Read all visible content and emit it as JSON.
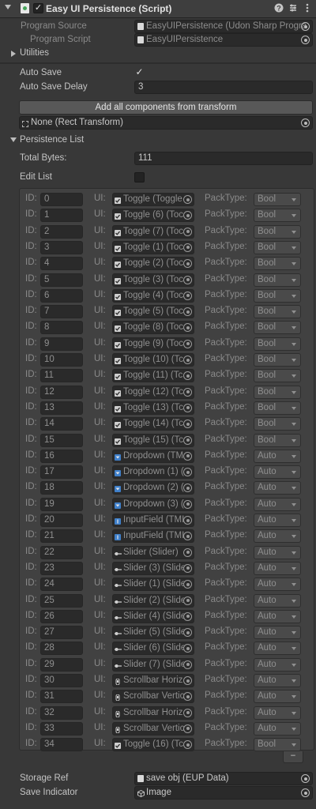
{
  "header": {
    "title": "Easy UI Persistence (Script)",
    "enabled": "✓",
    "help_icon": "help-icon",
    "preset_icon": "preset-icon",
    "menu_icon": "kebab-menu-icon"
  },
  "program_source": {
    "label": "Program Source",
    "value": "EasyUIPersistence (Udon Sharp Progra"
  },
  "program_script": {
    "label": "Program Script",
    "value": "EasyUIPersistence"
  },
  "utilities_label": "Utilities",
  "auto_save": {
    "label": "Auto Save",
    "value": "✓"
  },
  "auto_save_delay": {
    "label": "Auto Save Delay",
    "value": "3"
  },
  "add_all_button": "Add all components from transform",
  "rect_transform_field": "None (Rect Transform)",
  "persistence_list": {
    "label": "Persistence List",
    "total_bytes_label": "Total Bytes:",
    "total_bytes_value": "111",
    "edit_list_label": "Edit List",
    "id_label": "ID:",
    "ui_label": "UI:",
    "packtype_label": "PackType:",
    "items": [
      {
        "id": "0",
        "ui": "Toggle (Toggle",
        "kind": "toggle",
        "pack": "Bool"
      },
      {
        "id": "1",
        "ui": "Toggle (6) (Toc",
        "kind": "toggle",
        "pack": "Bool"
      },
      {
        "id": "2",
        "ui": "Toggle (7) (Toc",
        "kind": "toggle",
        "pack": "Bool"
      },
      {
        "id": "3",
        "ui": "Toggle (1) (Toc",
        "kind": "toggle",
        "pack": "Bool"
      },
      {
        "id": "4",
        "ui": "Toggle (2) (Toc",
        "kind": "toggle",
        "pack": "Bool"
      },
      {
        "id": "5",
        "ui": "Toggle (3) (Toc",
        "kind": "toggle",
        "pack": "Bool"
      },
      {
        "id": "6",
        "ui": "Toggle (4) (Toc",
        "kind": "toggle",
        "pack": "Bool"
      },
      {
        "id": "7",
        "ui": "Toggle (5) (Toc",
        "kind": "toggle",
        "pack": "Bool"
      },
      {
        "id": "8",
        "ui": "Toggle (8) (Toc",
        "kind": "toggle",
        "pack": "Bool"
      },
      {
        "id": "9",
        "ui": "Toggle (9) (Toc",
        "kind": "toggle",
        "pack": "Bool"
      },
      {
        "id": "10",
        "ui": "Toggle (10) (Tc",
        "kind": "toggle",
        "pack": "Bool"
      },
      {
        "id": "11",
        "ui": "Toggle (11) (Tc",
        "kind": "toggle",
        "pack": "Bool"
      },
      {
        "id": "12",
        "ui": "Toggle (12) (Tc",
        "kind": "toggle",
        "pack": "Bool"
      },
      {
        "id": "13",
        "ui": "Toggle (13) (Tc",
        "kind": "toggle",
        "pack": "Bool"
      },
      {
        "id": "14",
        "ui": "Toggle (14) (Tc",
        "kind": "toggle",
        "pack": "Bool"
      },
      {
        "id": "15",
        "ui": "Toggle (15) (Tc",
        "kind": "toggle",
        "pack": "Bool"
      },
      {
        "id": "16",
        "ui": "Dropdown (TM",
        "kind": "dropdown",
        "pack": "Auto"
      },
      {
        "id": "17",
        "ui": "Dropdown (1) (",
        "kind": "dropdown",
        "pack": "Auto"
      },
      {
        "id": "18",
        "ui": "Dropdown (2) (",
        "kind": "dropdown",
        "pack": "Auto"
      },
      {
        "id": "19",
        "ui": "Dropdown (3) (",
        "kind": "dropdown",
        "pack": "Auto"
      },
      {
        "id": "20",
        "ui": "InputField (TMI",
        "kind": "input",
        "pack": "Auto"
      },
      {
        "id": "21",
        "ui": "InputField (TMI",
        "kind": "input",
        "pack": "Auto"
      },
      {
        "id": "22",
        "ui": "Slider (Slider)",
        "kind": "slider",
        "pack": "Auto"
      },
      {
        "id": "23",
        "ui": "Slider (3) (Slide",
        "kind": "slider",
        "pack": "Auto"
      },
      {
        "id": "24",
        "ui": "Slider (1) (Slide",
        "kind": "slider",
        "pack": "Auto"
      },
      {
        "id": "25",
        "ui": "Slider (2) (Slide",
        "kind": "slider",
        "pack": "Auto"
      },
      {
        "id": "26",
        "ui": "Slider (4) (Slide",
        "kind": "slider",
        "pack": "Auto"
      },
      {
        "id": "27",
        "ui": "Slider (5) (Slide",
        "kind": "slider",
        "pack": "Auto"
      },
      {
        "id": "28",
        "ui": "Slider (6) (Slide",
        "kind": "slider",
        "pack": "Auto"
      },
      {
        "id": "29",
        "ui": "Slider (7) (Slide",
        "kind": "slider",
        "pack": "Auto"
      },
      {
        "id": "30",
        "ui": "Scrollbar Horiz",
        "kind": "scrollbar",
        "pack": "Auto"
      },
      {
        "id": "31",
        "ui": "Scrollbar Vertic",
        "kind": "scrollbar",
        "pack": "Auto"
      },
      {
        "id": "32",
        "ui": "Scrollbar Horiz",
        "kind": "scrollbar",
        "pack": "Auto"
      },
      {
        "id": "33",
        "ui": "Scrollbar Vertic",
        "kind": "scrollbar",
        "pack": "Auto"
      },
      {
        "id": "34",
        "ui": "Toggle (16) (Tc",
        "kind": "toggle",
        "pack": "Bool"
      }
    ],
    "remove_button": "−"
  },
  "storage_ref": {
    "label": "Storage Ref",
    "value": "save obj (EUP Data)"
  },
  "save_indicator": {
    "label": "Save Indicator",
    "value": "Image"
  },
  "colors": {
    "background": "#383838",
    "field": "#2a2a2a",
    "button": "#585858",
    "toggle_icon": "#cfcfcf",
    "dropdown_icon": "#3f7fc9",
    "input_icon": "#3f7fc9"
  }
}
